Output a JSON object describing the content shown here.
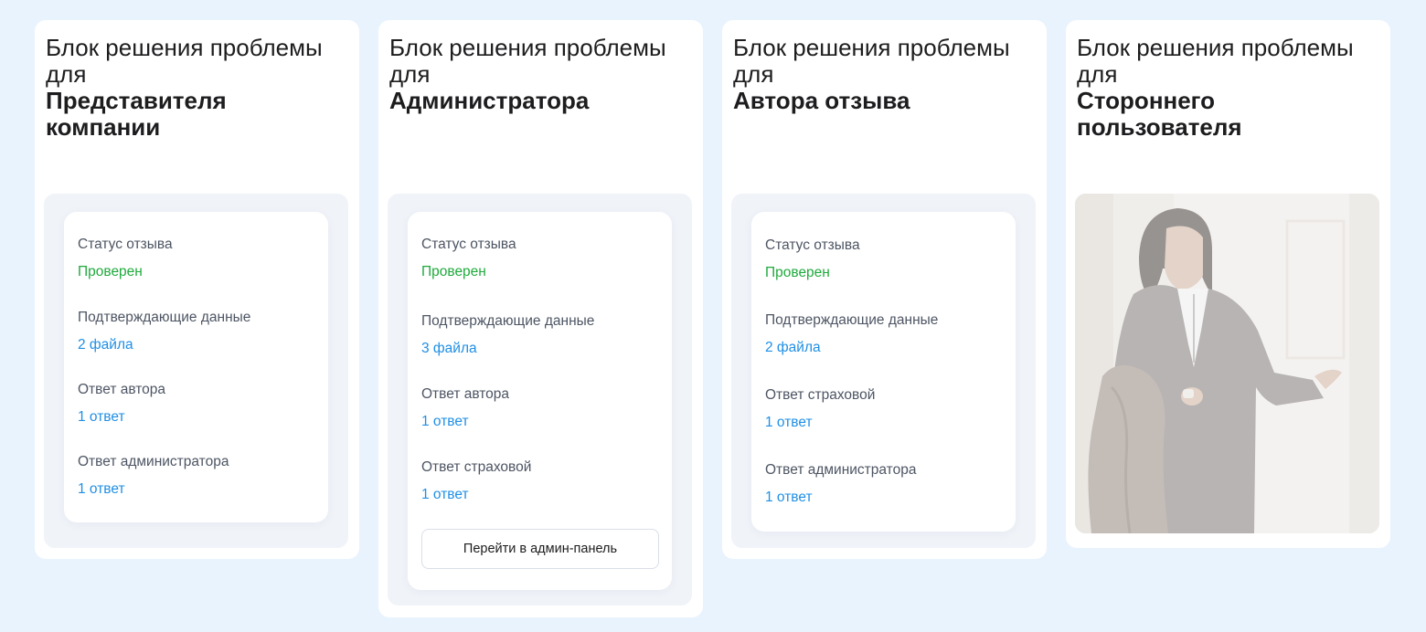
{
  "cards": [
    {
      "title_light": "Блок решения проблемы для",
      "title_bold": "Представителя компании",
      "fields": [
        {
          "label": "Статус отзыва",
          "value": "Проверен"
        },
        {
          "label": "Подтверждающие данные",
          "value": "2 файла"
        },
        {
          "label": "Ответ автора",
          "value": "1 ответ"
        },
        {
          "label": "Ответ администратора",
          "value": "1 ответ"
        }
      ]
    },
    {
      "title_light": "Блок решения проблемы для",
      "title_bold": "Администратора",
      "fields": [
        {
          "label": "Статус отзыва",
          "value": "Проверен"
        },
        {
          "label": "Подтверждающие данные",
          "value": "3 файла"
        },
        {
          "label": "Ответ автора",
          "value": "1 ответ"
        },
        {
          "label": "Ответ страховой",
          "value": "1 ответ"
        }
      ],
      "button_label": "Перейти в админ-панель"
    },
    {
      "title_light": "Блок решения проблемы для",
      "title_bold": "Автора отзыва",
      "fields": [
        {
          "label": "Статус отзыва",
          "value": "Проверен"
        },
        {
          "label": "Подтверждающие данные",
          "value": "2 файла"
        },
        {
          "label": "Ответ страховой",
          "value": "1 ответ"
        },
        {
          "label": "Ответ администратора",
          "value": "1 ответ"
        }
      ]
    },
    {
      "title_light": "Блок решения проблемы для",
      "title_bold": "Стороннего пользователя",
      "image": "confused-man-in-suit-photo"
    }
  ],
  "colors": {
    "background": "#e8f3fd",
    "status_green": "#1faa3c",
    "link_blue": "#1f8fe5"
  }
}
